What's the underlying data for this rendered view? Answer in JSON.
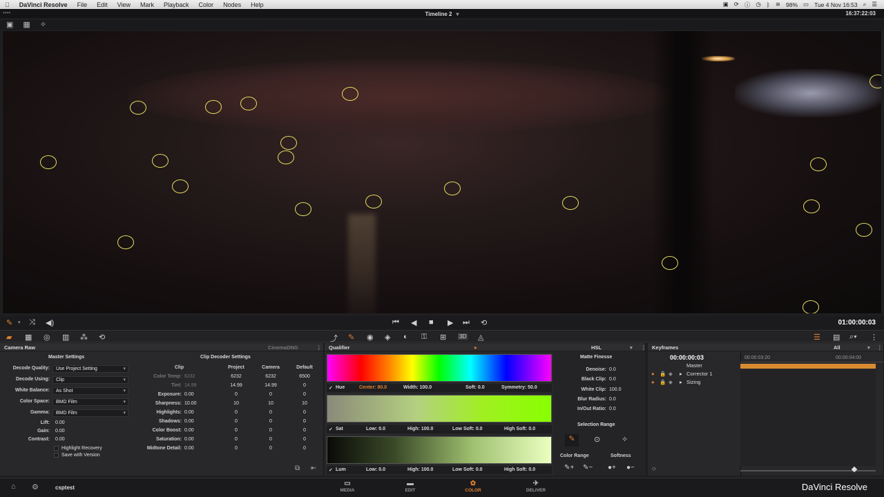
{
  "menubar": {
    "apple": "",
    "app_name": "DaVinci Resolve",
    "menus": [
      "File",
      "Edit",
      "View",
      "Mark",
      "Playback",
      "Color",
      "Nodes",
      "Help"
    ],
    "battery": "98%",
    "datetime": "Tue 4 Nov 16:53"
  },
  "titlebar": {
    "dots": "••••",
    "title": "Timeline 2",
    "timecode": "16:37:22:03"
  },
  "transport": {
    "timecode": "01:00:00:03"
  },
  "camera_raw": {
    "title": "Camera Raw",
    "format": "CinemaDNG",
    "master_title": "Master Settings",
    "decode_quality_label": "Decode Quality:",
    "decode_quality": "Use Project Setting",
    "decode_using_label": "Decode Using:",
    "decode_using": "Clip",
    "white_balance_label": "White Balance:",
    "white_balance": "As Shot",
    "color_space_label": "Color Space:",
    "color_space": "BMD Film",
    "gamma_label": "Gamma:",
    "gamma": "BMD Film",
    "lift_label": "Lift:",
    "lift": "0.00",
    "gain_label": "Gain:",
    "gain": "0.00",
    "contrast_label": "Contrast:",
    "contrast": "0.00",
    "highlight_recovery": "Highlight Recovery",
    "save_with_version": "Save with Version",
    "decoder_title": "Clip Decoder Settings",
    "col_headers": [
      "Clip",
      "Project",
      "Camera",
      "Default"
    ],
    "rows": [
      {
        "label": "Color Temp:",
        "clip": "6232",
        "project": "6232",
        "camera": "6232",
        "default": "6500",
        "dim": true
      },
      {
        "label": "Tint:",
        "clip": "14.99",
        "project": "14.99",
        "camera": "14.99",
        "default": "0",
        "dim": true
      },
      {
        "label": "Exposure:",
        "clip": "0.00",
        "project": "0",
        "camera": "0",
        "default": "0"
      },
      {
        "label": "Sharpness:",
        "clip": "10.00",
        "project": "10",
        "camera": "10",
        "default": "10"
      },
      {
        "label": "Highlights:",
        "clip": "0.00",
        "project": "0",
        "camera": "0",
        "default": "0"
      },
      {
        "label": "Shadows:",
        "clip": "0.00",
        "project": "0",
        "camera": "0",
        "default": "0"
      },
      {
        "label": "Color Boost:",
        "clip": "0.00",
        "project": "0",
        "camera": "0",
        "default": "0"
      },
      {
        "label": "Saturation:",
        "clip": "0.00",
        "project": "0",
        "camera": "0",
        "default": "0"
      },
      {
        "label": "Midtone Detail:",
        "clip": "0.00",
        "project": "0",
        "camera": "0",
        "default": "0"
      }
    ]
  },
  "qualifier": {
    "title": "Qualifier",
    "mode": "HSL",
    "hue": {
      "name": "Hue",
      "center": "Center: 80.0",
      "width": "Width: 100.0",
      "soft": "Soft: 0.0",
      "symmetry": "Symmetry: 50.0"
    },
    "sat": {
      "name": "Sat",
      "low": "Low: 0.0",
      "high": "High: 100.0",
      "low_soft": "Low Soft: 0.0",
      "high_soft": "High Soft: 0.0"
    },
    "lum": {
      "name": "Lum",
      "low": "Low: 0.0",
      "high": "High: 100.0",
      "low_soft": "Low Soft: 0.0",
      "high_soft": "High Soft: 0.0"
    },
    "matte_title": "Matte Finesse",
    "denoise_label": "Denoise:",
    "denoise": "0.0",
    "black_clip_label": "Black Clip:",
    "black_clip": "0.0",
    "white_clip_label": "White Clip:",
    "white_clip": "100.0",
    "blur_label": "Blur Radius:",
    "blur": "0.0",
    "inout_label": "In/Out Ratio:",
    "inout": "0.0",
    "selection_range": "Selection Range",
    "color_range": "Color Range",
    "softness": "Softness"
  },
  "keyframes": {
    "title": "Keyframes",
    "filter": "All",
    "timecode": "00:00:00:03",
    "ruler": [
      "00:00:03:20",
      "00:00:04:00"
    ],
    "tracks": [
      "Master",
      "Corrector 1",
      "Sizing"
    ]
  },
  "bottombar": {
    "project": "csptest",
    "pages": [
      "MEDIA",
      "EDIT",
      "COLOR",
      "DELIVER"
    ],
    "active_page": "COLOR",
    "brand": "DaVinci Resolve"
  },
  "colors": {
    "accent": "#e08030",
    "marker": "#e8e060"
  }
}
